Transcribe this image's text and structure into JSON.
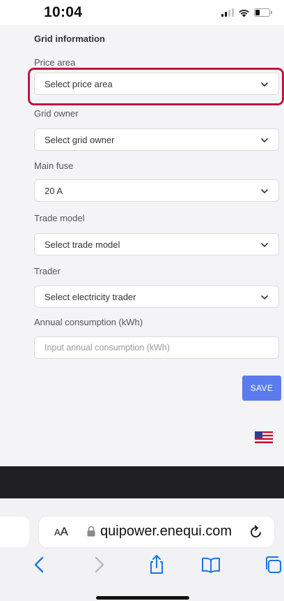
{
  "status_bar": {
    "time": "10:04"
  },
  "form": {
    "section_title": "Grid information",
    "fields": [
      {
        "label": "Price area",
        "value": "Select price area"
      },
      {
        "label": "Grid owner",
        "value": "Select grid owner"
      },
      {
        "label": "Main fuse",
        "value": "20 A"
      },
      {
        "label": "Trade model",
        "value": "Select trade model"
      },
      {
        "label": "Trader",
        "value": "Select electricity trader"
      }
    ],
    "consumption": {
      "label": "Annual consumption (kWh)",
      "placeholder": "Input annual consumption (kWh)"
    },
    "save_label": "SAVE"
  },
  "browser": {
    "aa_label_small": "A",
    "aa_label_large": "A",
    "url": "quipower.enequi.com"
  },
  "colors": {
    "accent": "#5b7bef",
    "highlight": "#c0163f",
    "ios_blue": "#1a73e8"
  },
  "icons": [
    "signal-icon",
    "wifi-icon",
    "battery-icon",
    "chevron-down-icon",
    "us-flag-icon",
    "lock-icon",
    "reload-icon",
    "back-icon",
    "forward-icon",
    "share-icon",
    "bookmarks-icon",
    "tabs-icon"
  ]
}
